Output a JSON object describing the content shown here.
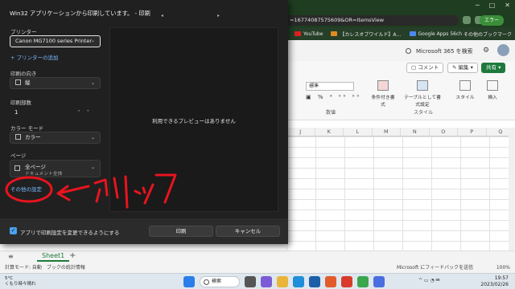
{
  "browser": {
    "url": "=16774087575609&OR=ItemsView",
    "profile_label": "エラー",
    "bookmarks": [
      "YouTube",
      "【カレスオブワイルド】A…",
      "Google Apps 56ch"
    ],
    "bookmarks_right": "その他のブックマーク"
  },
  "excel": {
    "search_text": "Microsoft 365 を検索",
    "comment_label": "コメント",
    "edit_label": "編集",
    "share_label": "共有",
    "number_format": "標準",
    "number_group": "数値",
    "style_group": "スタイル",
    "tools": [
      "条件付き書式",
      "テーブルとして書式設定",
      "スタイル",
      "挿入"
    ],
    "columns": [
      "J",
      "K",
      "L",
      "M",
      "N",
      "O",
      "P",
      "Q"
    ],
    "sheet_tab": "Sheet1",
    "status_left": "計算モード: 自動　ブックの統計情報",
    "status_feedback": "Microsoft にフィードバックを送信",
    "zoom": "100%"
  },
  "taskbar": {
    "weather_temp": "5°C",
    "weather_desc": "くもり時々晴れ",
    "search_label": "検索",
    "time": "19:57",
    "date": "2023/02/26"
  },
  "dialog": {
    "title": "Win32 アプリケーションから印刷しています。 - 印刷",
    "printer_label": "プリンター",
    "printer_value": "Canon MG7100 series Printer",
    "add_printer": "+ プリンターの追加",
    "orientation_label": "印刷の向き",
    "orientation_value": "縦",
    "copies_label": "印刷部数",
    "copies_value": "1",
    "color_label": "カラー モード",
    "color_value": "カラー",
    "pages_label": "ページ",
    "pages_value": "全ページ",
    "pages_sub": "ドキュメント全体",
    "other_settings": "その他の設定",
    "preview_message": "利用できるプレビューはありません",
    "checkbox_label": "アプリで印刷設定を変更できるようにする",
    "print_button": "印刷",
    "cancel_button": "キャンセル"
  },
  "annotation": {
    "text": "クリック",
    "color": "#e8141e"
  },
  "colors": {
    "dialog_bg": "#202020",
    "link": "#79b8ff",
    "excel_green": "#1e7a3c"
  }
}
